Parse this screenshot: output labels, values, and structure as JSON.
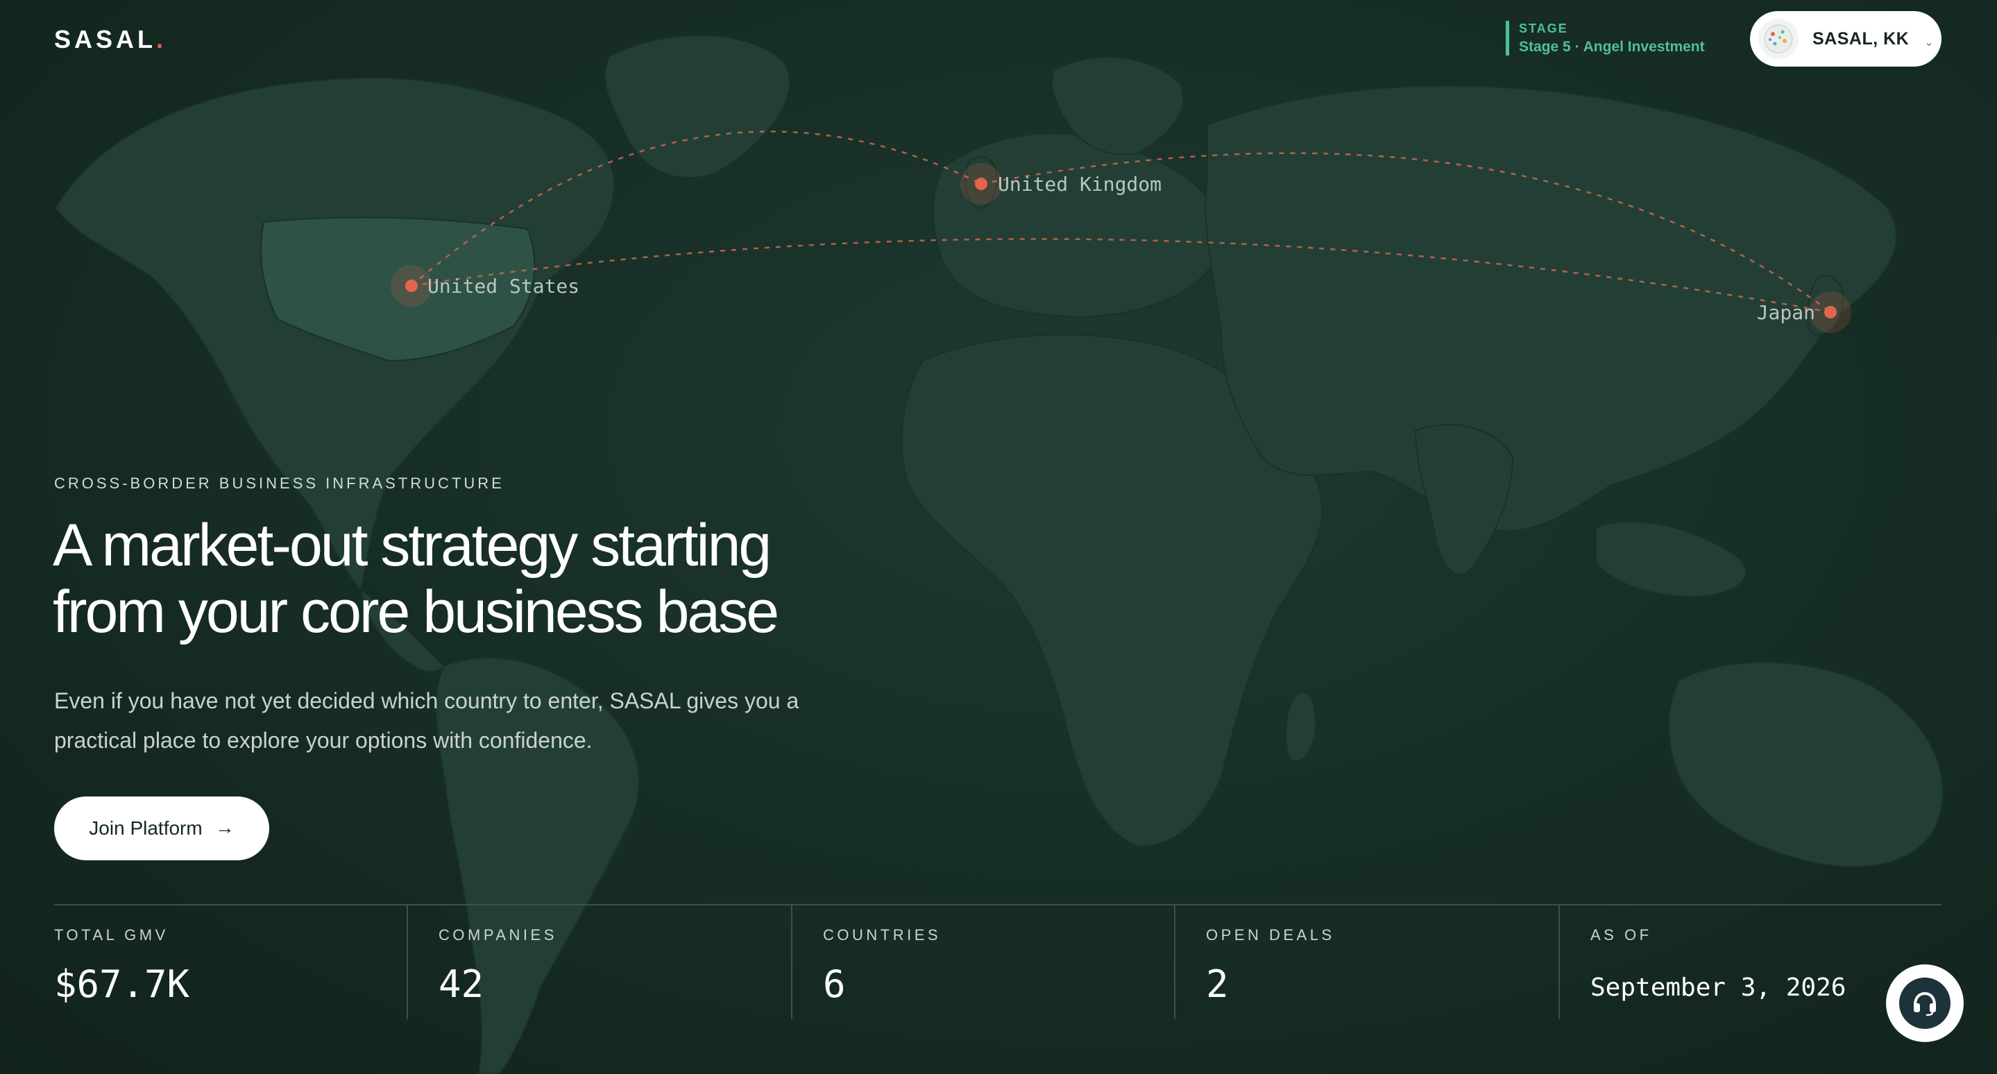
{
  "brand": {
    "name": "SASAL",
    "dot": "."
  },
  "header": {
    "stage_label": "STAGE",
    "stage_value": "Stage 5 · Angel Investment",
    "company_name": "SASAL, KK",
    "avatar_icon": "globe-icon",
    "chevron_icon": "chevron-down-icon"
  },
  "map": {
    "locations": [
      {
        "label": "United States"
      },
      {
        "label": "United Kingdom"
      },
      {
        "label": "Japan"
      }
    ],
    "marker_color": "#e1664c"
  },
  "hero": {
    "eyebrow": "CROSS-BORDER BUSINESS INFRASTRUCTURE",
    "headline_line1": "A market-out strategy starting",
    "headline_line2": "from your core business base",
    "subtext_line1": "Even if you have not yet decided which country to enter, SASAL gives you a",
    "subtext_line2": "practical place to explore your options with confidence.",
    "cta_label": "Join Platform",
    "cta_arrow": "→"
  },
  "stats": [
    {
      "label": "TOTAL GMV",
      "value": "$67.7K"
    },
    {
      "label": "COMPANIES",
      "value": "42"
    },
    {
      "label": "COUNTRIES",
      "value": "6"
    },
    {
      "label": "OPEN DEALS",
      "value": "2"
    },
    {
      "label": "AS OF",
      "value": "September 3, 2026"
    }
  ],
  "support": {
    "icon": "headset-icon"
  },
  "colors": {
    "background": "#152821",
    "accent": "#4fbfa0",
    "marker": "#e1664c",
    "land": "#244036",
    "highlight_land": "#2e5246"
  }
}
